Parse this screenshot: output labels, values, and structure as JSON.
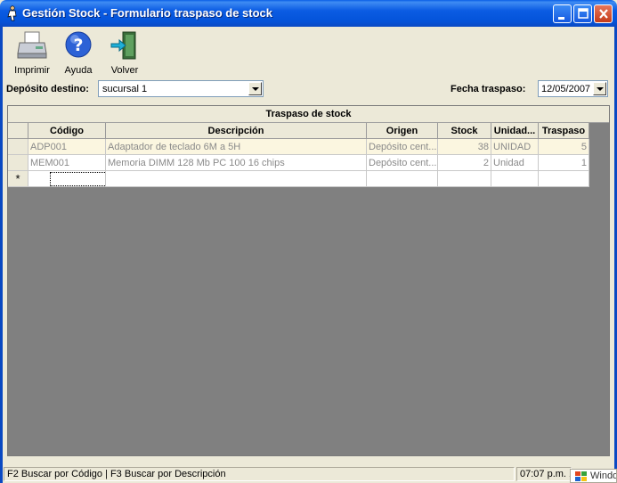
{
  "window": {
    "title": "Gestión Stock - Formulario traspaso de stock"
  },
  "toolbar": {
    "print_label": "Imprimir",
    "help_label": "Ayuda",
    "back_label": "Volver"
  },
  "form": {
    "destino_label": "Depósito destino:",
    "destino_value": "sucursal 1",
    "fecha_label": "Fecha traspaso:",
    "fecha_value": "12/05/2007"
  },
  "grid": {
    "caption": "Traspaso de stock",
    "columns": [
      "Código",
      "Descripción",
      "Origen",
      "Stock",
      "Unidad...",
      "Traspaso"
    ],
    "rows": [
      {
        "codigo": "ADP001",
        "descripcion": "Adaptador de teclado 6M a 5H",
        "origen": "Depósito cent...",
        "stock": "38",
        "unidad": "UNIDAD",
        "traspaso": "5"
      },
      {
        "codigo": "MEM001",
        "descripcion": "Memoria DIMM 128 Mb PC 100 16 chips",
        "origen": "Depósito cent...",
        "stock": "2",
        "unidad": "Unidad",
        "traspaso": "1"
      }
    ],
    "new_row_marker": "*"
  },
  "statusbar": {
    "hint": "F2 Buscar por Código | F3 Buscar por Descripción",
    "time": "07:07 p.m. 1",
    "taskbar_label": "Windo"
  },
  "colors": {
    "titlebar": "#0453d9",
    "grid_background": "#808080",
    "dialog": "#ece9d8"
  },
  "icons": [
    "app-icon",
    "printer-icon",
    "help-icon",
    "exit-door-icon",
    "chevron-down-icon",
    "windows-logo-icon"
  ]
}
